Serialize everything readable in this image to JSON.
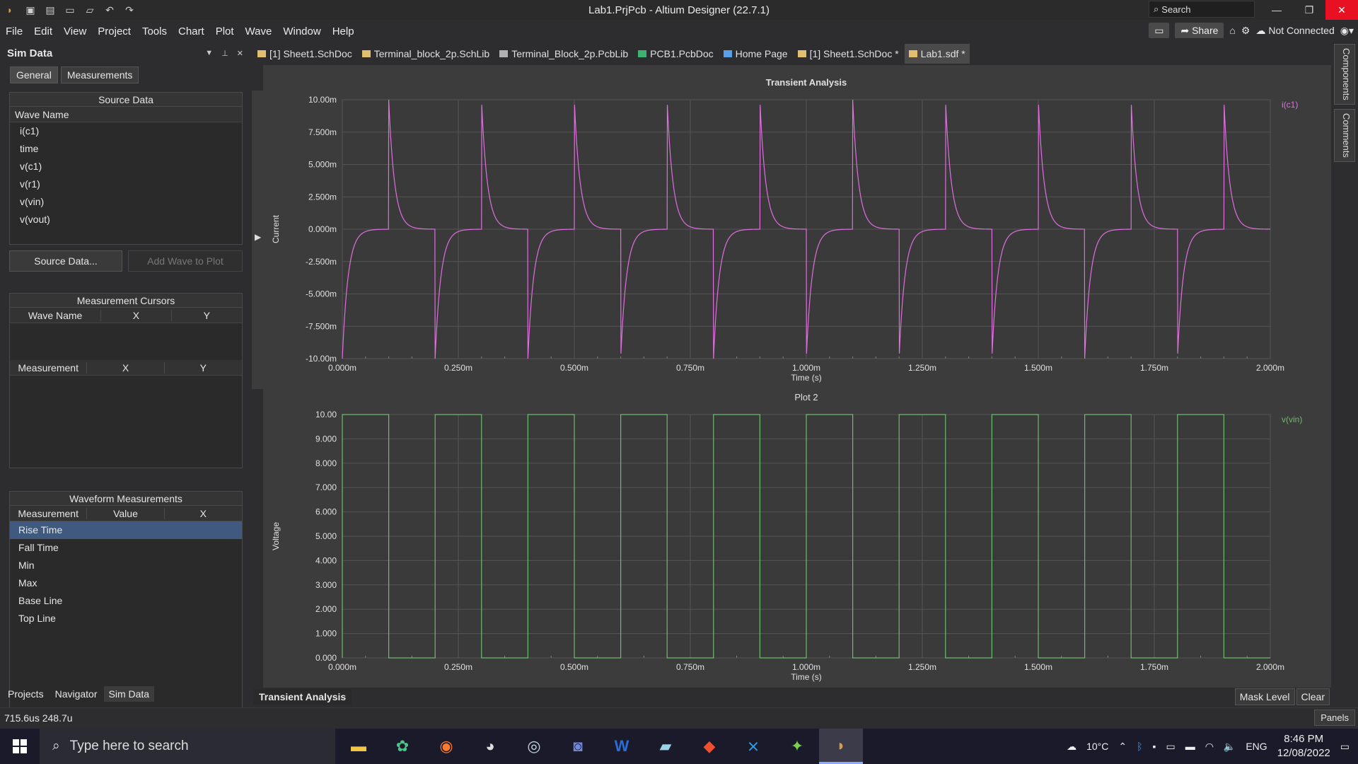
{
  "window": {
    "title": "Lab1.PrjPcb - Altium Designer (22.7.1)",
    "search_placeholder": "Search"
  },
  "menu": [
    "File",
    "Edit",
    "View",
    "Project",
    "Tools",
    "Chart",
    "Plot",
    "Wave",
    "Window",
    "Help"
  ],
  "menu_right": {
    "share": "Share",
    "connection": "Not Connected"
  },
  "panel": {
    "title": "Sim Data",
    "tabs": [
      "General",
      "Measurements"
    ],
    "source_data": {
      "title": "Source Data",
      "column": "Wave Name",
      "items": [
        "i(c1)",
        "time",
        "v(c1)",
        "v(r1)",
        "v(vin)",
        "v(vout)"
      ]
    },
    "buttons": {
      "source": "Source Data...",
      "add": "Add Wave to Plot"
    },
    "cursors": {
      "title": "Measurement Cursors",
      "columns": [
        "Wave Name",
        "X",
        "Y"
      ],
      "columns2": [
        "Measurement",
        "X",
        "Y"
      ]
    },
    "waveform": {
      "title": "Waveform Measurements",
      "columns": [
        "Measurement",
        "Value",
        "X"
      ],
      "items": [
        "Rise Time",
        "Fall Time",
        "Min",
        "Max",
        "Base Line",
        "Top Line"
      ],
      "selected": "Rise Time"
    },
    "bottom_tabs": [
      "Projects",
      "Navigator",
      "Sim Data"
    ]
  },
  "doc_tabs": [
    {
      "label": "[1] Sheet1.SchDoc",
      "color": "#e0c070"
    },
    {
      "label": "Terminal_block_2p.SchLib",
      "color": "#e0c070"
    },
    {
      "label": "Terminal_Block_2p.PcbLib",
      "color": "#b0b0b0"
    },
    {
      "label": "PCB1.PcbDoc",
      "color": "#3cb371"
    },
    {
      "label": "Home Page",
      "color": "#5aa0e6"
    },
    {
      "label": "[1] Sheet1.SchDoc *",
      "color": "#e0c070"
    },
    {
      "label": "Lab1.sdf *",
      "color": "#e0c070"
    }
  ],
  "right_rail": [
    "Components",
    "Comments"
  ],
  "chart_data": [
    {
      "type": "line",
      "title": "Transient Analysis",
      "xlabel": "Time (s)",
      "ylabel": "Current",
      "x_ticks": [
        "0.000m",
        "0.250m",
        "0.500m",
        "0.750m",
        "1.000m",
        "1.250m",
        "1.500m",
        "1.750m",
        "2.000m"
      ],
      "y_ticks": [
        "10.00m",
        "7.500m",
        "5.000m",
        "2.500m",
        "0.000m",
        "-2.500m",
        "-5.000m",
        "-7.500m",
        "-10.00m"
      ],
      "xlim": [
        0,
        2.0
      ],
      "ylim": [
        -10,
        10
      ],
      "x_unit": "ms",
      "y_unit": "mA",
      "series": [
        {
          "name": "i(c1)",
          "color": "#e06ee0",
          "period": 0.2,
          "high_time": 0.1,
          "tau": 0.0125,
          "peak": 10
        }
      ]
    },
    {
      "type": "line",
      "title": "Plot 2",
      "xlabel": "Time (s)",
      "ylabel": "Voltage",
      "x_ticks": [
        "0.000m",
        "0.250m",
        "0.500m",
        "0.750m",
        "1.000m",
        "1.250m",
        "1.500m",
        "1.750m",
        "2.000m"
      ],
      "y_ticks": [
        "10.00",
        "9.000",
        "8.000",
        "7.000",
        "6.000",
        "5.000",
        "4.000",
        "3.000",
        "2.000",
        "1.000",
        "0.000"
      ],
      "xlim": [
        0,
        2.0
      ],
      "ylim": [
        0,
        10
      ],
      "x_unit": "ms",
      "series": [
        {
          "name": "v(vin)",
          "color": "#6dbb6d",
          "period": 0.2,
          "high_time": 0.1,
          "high": 10,
          "low": 0
        }
      ]
    }
  ],
  "plot_footer": {
    "tab": "Transient Analysis",
    "mask": "Mask Level",
    "clear": "Clear"
  },
  "status": {
    "coords": "715.6us 248.7u",
    "panels": "Panels"
  },
  "taskbar": {
    "search": "Type here to search",
    "weather": "10°C",
    "lang": "ENG",
    "time": "8:46 PM",
    "date": "12/08/2022"
  }
}
